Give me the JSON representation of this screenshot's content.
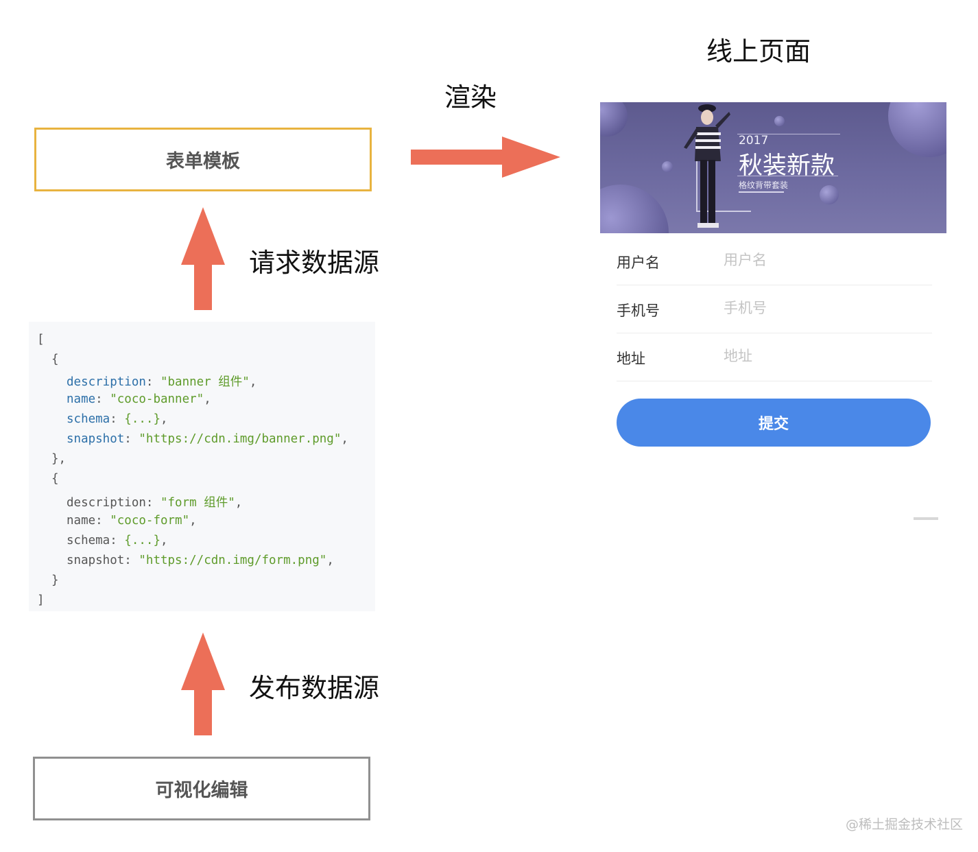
{
  "colors": {
    "arrow": "#ec6f58",
    "template_border": "#e8b33f",
    "editor_border": "#909090",
    "button": "#4a88e8"
  },
  "nodes": {
    "form_template": "表单模板",
    "visual_editor": "可视化编辑"
  },
  "edges": {
    "render": "渲染",
    "request_datasource": "请求数据源",
    "publish_datasource": "发布数据源"
  },
  "code": {
    "open_bracket": "[",
    "close_bracket": "]",
    "items": [
      {
        "open": "{",
        "desc_key": "description",
        "desc_val": "\"banner 组件\"",
        "name_key": "name",
        "name_val": "\"coco-banner\"",
        "schema_key": "schema",
        "schema_val": "{...}",
        "snap_key": "snapshot",
        "snap_val": "\"https://cdn.img/banner.png\"",
        "close": "},"
      },
      {
        "open": "{",
        "desc_key": "description",
        "desc_val": "\"form 组件\"",
        "name_key": "name",
        "name_val": "\"coco-form\"",
        "schema_key": "schema",
        "schema_val": "{...}",
        "snap_key": "snapshot",
        "snap_val": "\"https://cdn.img/form.png\"",
        "close": "}"
      }
    ]
  },
  "online_page": {
    "title": "线上页面",
    "banner": {
      "year": "2017",
      "headline": "秋装新款",
      "subline": "格纹背带套装"
    },
    "form": [
      {
        "label": "用户名",
        "placeholder": "用户名"
      },
      {
        "label": "手机号",
        "placeholder": "手机号"
      },
      {
        "label": "地址",
        "placeholder": "地址"
      }
    ],
    "submit_label": "提交"
  },
  "watermark": "@稀土掘金技术社区"
}
